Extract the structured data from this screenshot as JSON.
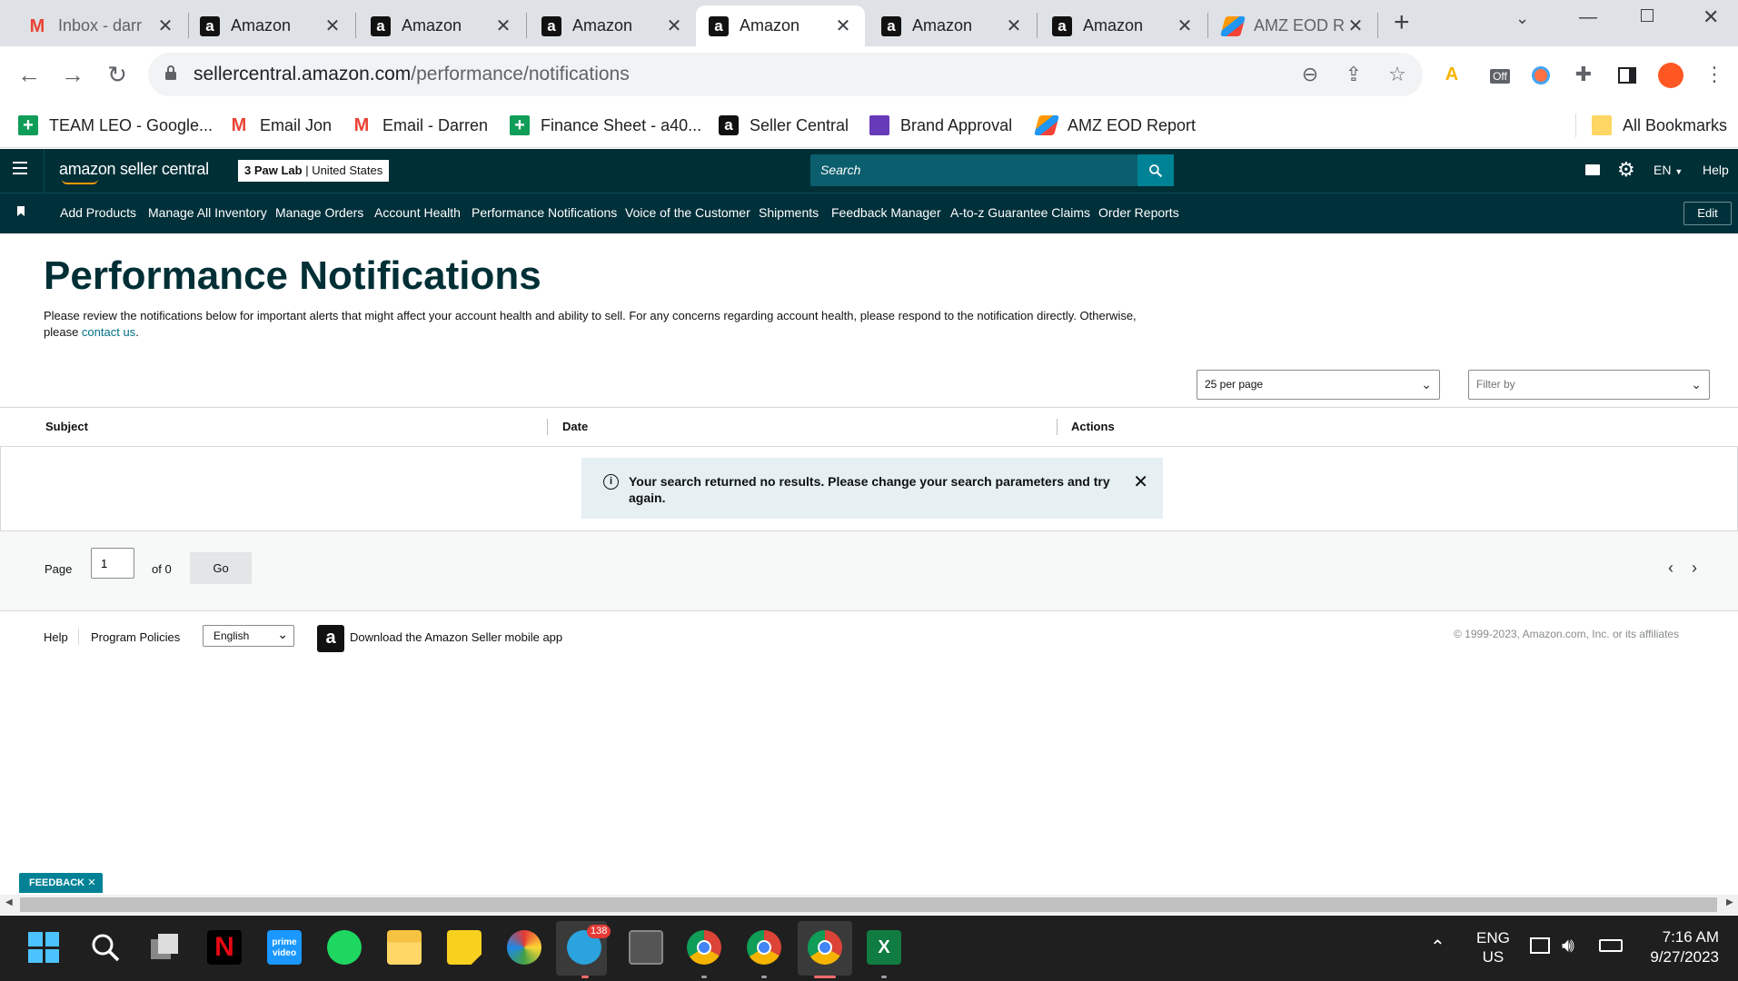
{
  "browser": {
    "tabs": [
      {
        "title": "Inbox - darr",
        "icon": "gmail-icon",
        "active": false
      },
      {
        "title": "Amazon",
        "icon": "amazon-icon",
        "active": false
      },
      {
        "title": "Amazon",
        "icon": "amazon-icon",
        "active": false
      },
      {
        "title": "Amazon",
        "icon": "amazon-icon",
        "active": false
      },
      {
        "title": "Amazon",
        "icon": "amazon-icon",
        "active": true
      },
      {
        "title": "Amazon",
        "icon": "amazon-icon",
        "active": false
      },
      {
        "title": "Amazon",
        "icon": "amazon-icon",
        "active": false
      },
      {
        "title": "AMZ EOD R",
        "icon": "amz-eod-icon",
        "active": false
      }
    ],
    "url_domain": "sellercentral.amazon.com",
    "url_path": "/performance/notifications",
    "bookmarks": [
      {
        "label": "TEAM LEO - Google...",
        "icon": "google-sheets-icon"
      },
      {
        "label": "Email Jon",
        "icon": "gmail-icon"
      },
      {
        "label": "Email - Darren",
        "icon": "gmail-icon"
      },
      {
        "label": "Finance Sheet - a40...",
        "icon": "google-sheets-icon"
      },
      {
        "label": "Seller Central",
        "icon": "amazon-icon"
      },
      {
        "label": "Brand Approval",
        "icon": "google-forms-icon"
      },
      {
        "label": "AMZ EOD Report",
        "icon": "amz-eod-icon"
      }
    ],
    "all_bookmarks": "All Bookmarks",
    "extension_off_badge": "Off"
  },
  "header": {
    "logo": "amazon seller central",
    "store_name": "3 Paw Lab",
    "store_region": "United States",
    "search_placeholder": "Search",
    "language": "EN",
    "help": "Help"
  },
  "nav": {
    "items": [
      "Add Products",
      "Manage All Inventory",
      "Manage Orders",
      "Account Health",
      "Performance Notifications",
      "Voice of the Customer",
      "Shipments",
      "Feedback Manager",
      "A-to-z Guarantee Claims",
      "Order Reports"
    ],
    "edit": "Edit"
  },
  "main": {
    "title": "Performance Notifications",
    "intro_text": "Please review the notifications below for important alerts that might affect your account health and ability to sell. For any concerns regarding account health, please respond to the notification directly. Otherwise, please ",
    "intro_link": "contact us",
    "intro_end": ".",
    "per_page": "25 per page",
    "filter_placeholder": "Filter by",
    "columns": [
      "Subject",
      "Date",
      "Actions"
    ],
    "alert": "Your search returned no results. Please change your search parameters and try again.",
    "pager": {
      "page_label": "Page",
      "page_value": "1",
      "of_label": "of 0",
      "go": "Go"
    }
  },
  "footer": {
    "help": "Help",
    "policies": "Program Policies",
    "language": "English",
    "app_link": "Download the Amazon Seller mobile app",
    "copyright": "© 1999-2023, Amazon.com, Inc. or its affiliates"
  },
  "feedback": "FEEDBACK",
  "taskbar": {
    "telegram_badge": "138",
    "lang_top": "ENG",
    "lang_bottom": "US",
    "time": "7:16 AM",
    "date": "9/27/2023"
  },
  "colors": {
    "header_bg": "#002f36",
    "accent": "#008296",
    "link": "#007185"
  }
}
